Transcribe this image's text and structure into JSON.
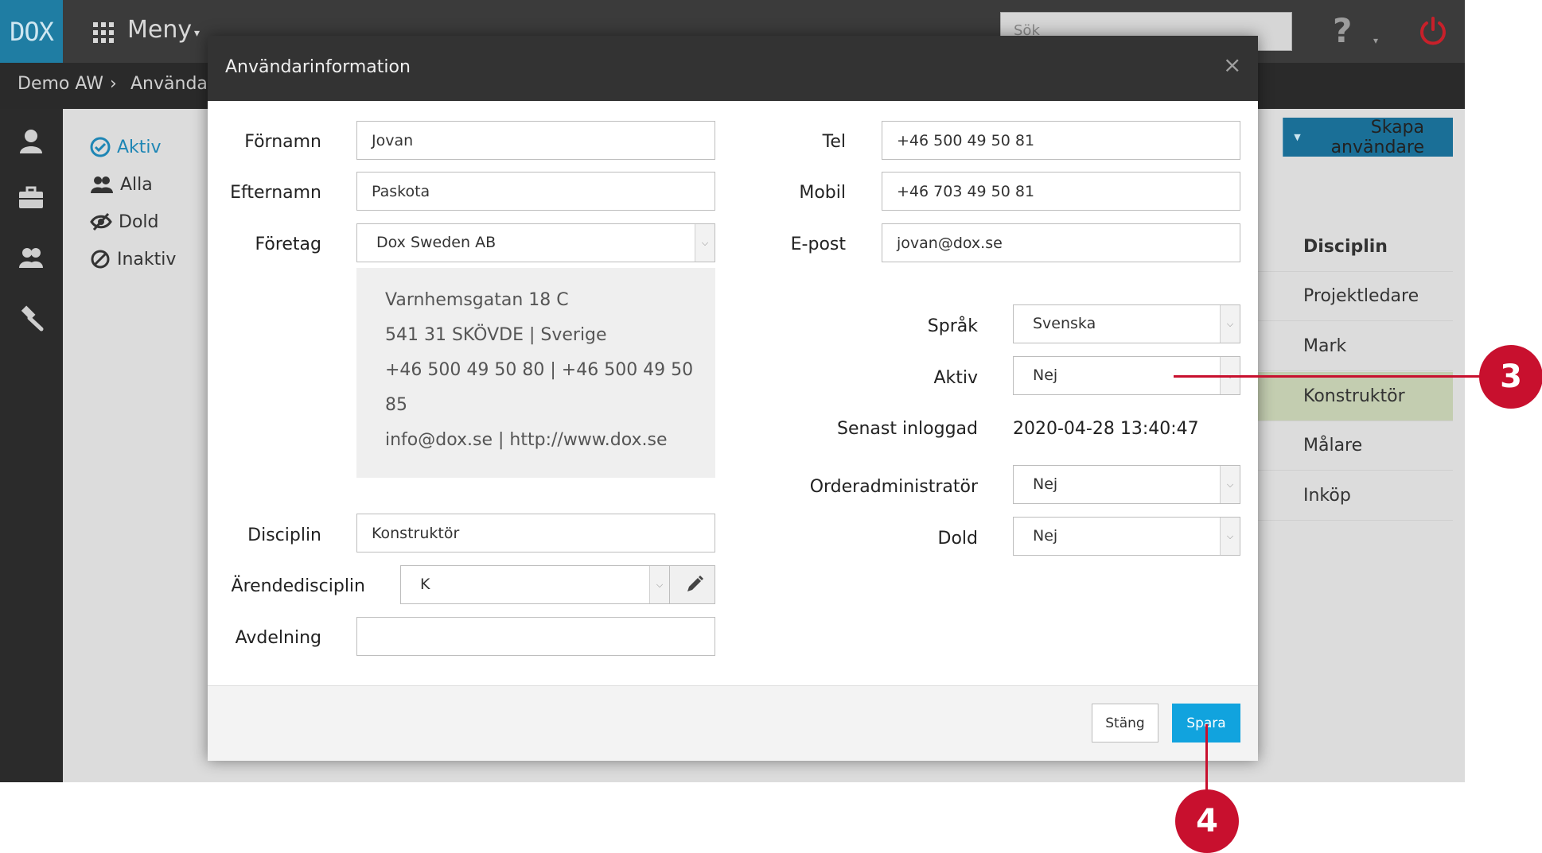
{
  "app": {
    "logo": "DOX",
    "menu_label": "Meny",
    "search_placeholder": "Sök",
    "breadcrumb": [
      "Demo AW",
      "Användar"
    ]
  },
  "filters": [
    "Aktiv",
    "Alla",
    "Dold",
    "Inaktiv"
  ],
  "background": {
    "create_button": "Skapa användare",
    "discipline_header": "Disciplin",
    "disciplines": [
      "Projektledare",
      "Mark",
      "Konstruktör",
      "Målare",
      "Inköp"
    ],
    "selected_discipline": "Konstruktör"
  },
  "modal": {
    "title": "Användarinformation",
    "close_symbol": "×",
    "left": {
      "first_name_label": "Förnamn",
      "first_name": "Jovan",
      "last_name_label": "Efternamn",
      "last_name": "Paskota",
      "company_label": "Företag",
      "company": "Dox Sweden AB",
      "address_lines": [
        "Varnhemsgatan 18 C",
        "541 31 SKÖVDE | Sverige",
        "+46 500 49 50 80 | +46 500 49 50",
        "85",
        "info@dox.se | http://www.dox.se"
      ],
      "discipline_label": "Disciplin",
      "discipline": "Konstruktör",
      "case_discipline_label": "Ärendedisciplin",
      "case_discipline": "K",
      "department_label": "Avdelning",
      "department": ""
    },
    "right": {
      "phone_label": "Tel",
      "phone": "+46 500 49 50 81",
      "mobile_label": "Mobil",
      "mobile": "+46 703 49 50 81",
      "email_label": "E-post",
      "email": "jovan@dox.se",
      "language_label": "Språk",
      "language": "Svenska",
      "active_label": "Aktiv",
      "active": "Nej",
      "last_login_label": "Senast inloggad",
      "last_login": "2020-04-28 13:40:47",
      "order_admin_label": "Orderadministratör",
      "order_admin": "Nej",
      "hidden_label": "Dold",
      "hidden": "Nej"
    },
    "footer": {
      "close_button": "Stäng",
      "save_button": "Spara"
    }
  },
  "callouts": [
    "3",
    "4"
  ],
  "colors": {
    "brand": "#1f7da3",
    "primary_button": "#11a3de",
    "callout": "#c8102e"
  },
  "icons": {
    "menu": "grid-icon",
    "help": "question-icon",
    "power": "power-icon",
    "filter_active": "check-circle-icon",
    "filter_all": "users-icon",
    "filter_hidden": "eye-slash-icon",
    "filter_inactive": "ban-icon",
    "edit": "pencil-icon"
  }
}
